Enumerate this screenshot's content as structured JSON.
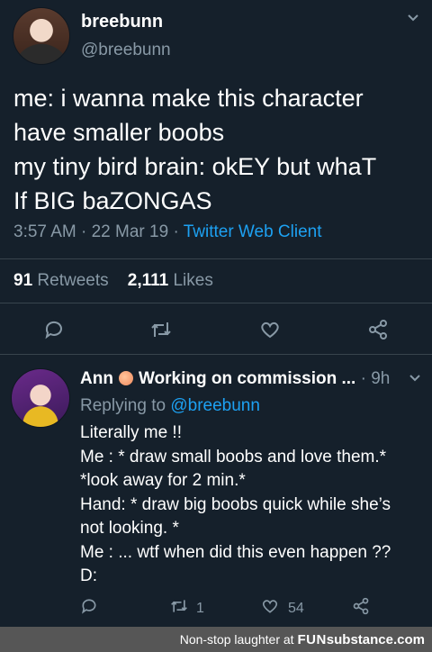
{
  "tweet": {
    "display_name": "breebunn",
    "handle": "@breebunn",
    "lines": [
      "me: i wanna make this character",
      "have smaller boobs",
      "my tiny bird brain: okEY but whaT",
      "If BIG baZONGAS"
    ],
    "time": "3:57 AM",
    "date": "22 Mar 19",
    "client": "Twitter Web Client",
    "retweets_count": "91",
    "retweets_label": "Retweets",
    "likes_count": "2,111",
    "likes_label": "Likes",
    "icons": [
      "reply-icon",
      "retweet-icon",
      "like-icon",
      "share-icon",
      "chevron-down-icon"
    ]
  },
  "reply": {
    "display_name": "Ann",
    "status_text": "Working on commission ...",
    "age": "9h",
    "replying_prefix": "Replying to",
    "replying_to": "@breebunn",
    "lines": [
      "Literally me !!",
      "Me : * draw small boobs and love them.*",
      "*look away for 2 min.*",
      "Hand: * draw big boobs quick while she’s",
      "not looking. *",
      "Me : ... wtf when did this even happen ??",
      "D:"
    ],
    "retweet_count": "1",
    "like_count": "54"
  },
  "footer": {
    "caption": "Non-stop laughter at",
    "brand_fun": "FUN",
    "brand_sub": "substance.com"
  },
  "colors": {
    "background": "#15202b",
    "secondary_text": "#8899a6",
    "link": "#1da1f2",
    "divider": "#38444d"
  }
}
